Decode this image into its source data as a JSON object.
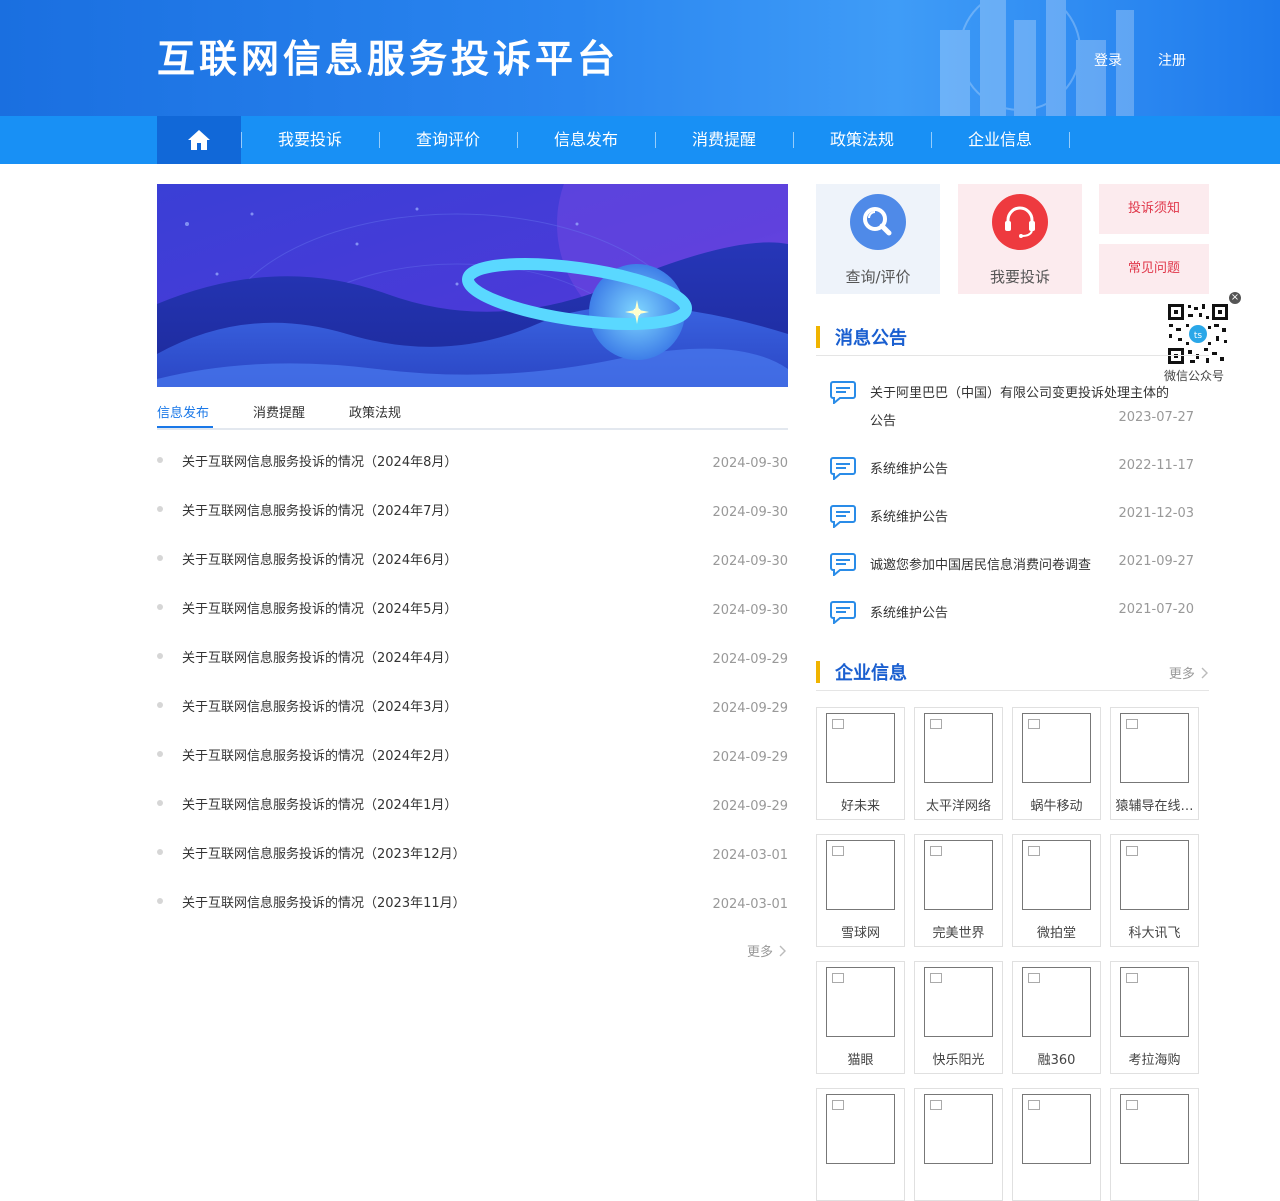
{
  "header": {
    "site_title": "互联网信息服务投诉平台",
    "login": "登录",
    "register": "注册"
  },
  "nav": {
    "home_icon": "home-icon",
    "items": [
      "我要投诉",
      "查询评价",
      "信息发布",
      "消费提醒",
      "政策法规",
      "企业信息"
    ]
  },
  "tabs": [
    "信息发布",
    "消费提醒",
    "政策法规"
  ],
  "active_tab": "信息发布",
  "news": [
    {
      "title": "关于互联网信息服务投诉的情况（2024年8月）",
      "date": "2024-09-30"
    },
    {
      "title": "关于互联网信息服务投诉的情况（2024年7月）",
      "date": "2024-09-30"
    },
    {
      "title": "关于互联网信息服务投诉的情况（2024年6月）",
      "date": "2024-09-30"
    },
    {
      "title": "关于互联网信息服务投诉的情况（2024年5月）",
      "date": "2024-09-30"
    },
    {
      "title": "关于互联网信息服务投诉的情况（2024年4月）",
      "date": "2024-09-29"
    },
    {
      "title": "关于互联网信息服务投诉的情况（2024年3月）",
      "date": "2024-09-29"
    },
    {
      "title": "关于互联网信息服务投诉的情况（2024年2月）",
      "date": "2024-09-29"
    },
    {
      "title": "关于互联网信息服务投诉的情况（2024年1月）",
      "date": "2024-09-29"
    },
    {
      "title": "关于互联网信息服务投诉的情况（2023年12月）",
      "date": "2024-03-01"
    },
    {
      "title": "关于互联网信息服务投诉的情况（2023年11月）",
      "date": "2024-03-01"
    }
  ],
  "news_more": "更多",
  "quick": {
    "query_label": "查询/评价",
    "complain_label": "我要投诉",
    "notice_label": "投诉须知",
    "faq_label": "常见问题",
    "query_color": "#4f8ae8",
    "complain_color": "#ee3a3f"
  },
  "qr": {
    "label": "微信公众号",
    "close": "×"
  },
  "announcements": {
    "title": "消息公告",
    "items": [
      {
        "title_line1": "关于阿里巴巴（中国）有限公司变更投诉处理主体的",
        "title_line2": "公告",
        "date": "2023-07-27"
      },
      {
        "title_line1": "系统维护公告",
        "title_line2": "",
        "date": "2022-11-17"
      },
      {
        "title_line1": "系统维护公告",
        "title_line2": "",
        "date": "2021-12-03"
      },
      {
        "title_line1": "诚邀您参加中国居民信息消费问卷调查",
        "title_line2": "",
        "date": "2021-09-27"
      },
      {
        "title_line1": "系统维护公告",
        "title_line2": "",
        "date": "2021-07-20"
      }
    ]
  },
  "companies": {
    "title": "企业信息",
    "more": "更多",
    "items": [
      "好未来",
      "太平洋网络",
      "蜗牛移动",
      "猿辅导在线…",
      "雪球网",
      "完美世界",
      "微拍堂",
      "科大讯飞",
      "猫眼",
      "快乐阳光",
      "融360",
      "考拉海购",
      "",
      "",
      "",
      ""
    ]
  },
  "colors": {
    "header_blue": "#1a6fe0",
    "nav_blue": "#1890f5",
    "home_bg": "#1168d8",
    "accent_yellow": "#f0b400",
    "link_blue": "#1a78e8"
  }
}
